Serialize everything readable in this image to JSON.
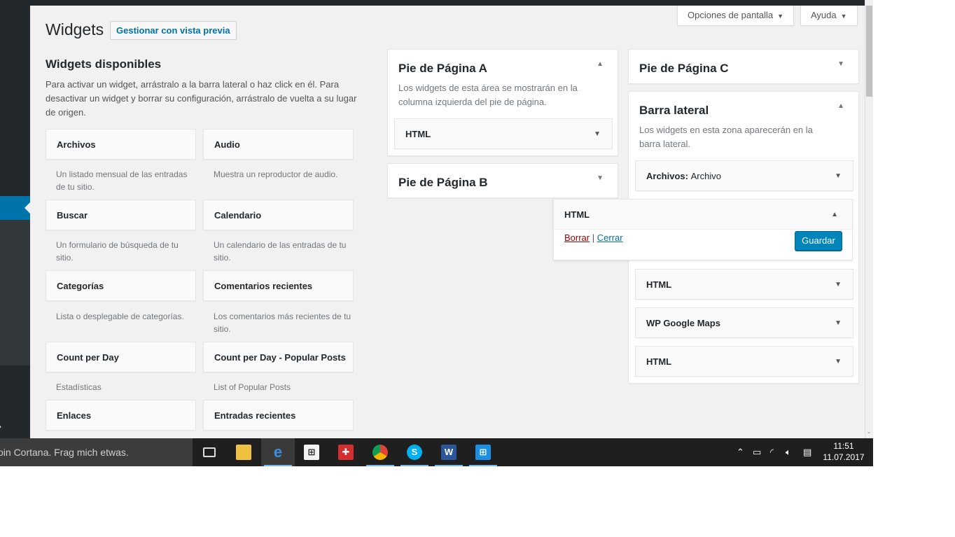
{
  "screen_meta": {
    "screen_options": "Opciones de pantalla",
    "help": "Ayuda"
  },
  "page": {
    "title": "Widgets",
    "preview_button": "Gestionar con vista previa"
  },
  "available": {
    "heading": "Widgets disponibles",
    "description": "Para activar un widget, arrástralo a la barra lateral o haz click en él. Para desactivar un widget y borrar su configuración, arrástralo de vuelta a su lugar de origen.",
    "widgets": [
      {
        "name": "Archivos",
        "desc": "Un listado mensual de las entradas de tu sitio."
      },
      {
        "name": "Audio",
        "desc": "Muestra un reproductor de audio."
      },
      {
        "name": "Buscar",
        "desc": "Un formulario de búsqueda de tu sitio."
      },
      {
        "name": "Calendario",
        "desc": "Un calendario de las entradas de tu sitio."
      },
      {
        "name": "Categorías",
        "desc": "Lista o desplegable de categorías."
      },
      {
        "name": "Comentarios recientes",
        "desc": "Los comentarios más recientes de tu sitio."
      },
      {
        "name": "Count per Day",
        "desc": "Estadísticas"
      },
      {
        "name": "Count per Day - Popular Posts",
        "desc": "List of Popular Posts"
      },
      {
        "name": "Enlaces",
        "desc": ""
      },
      {
        "name": "Entradas recientes",
        "desc": ""
      }
    ]
  },
  "areas": {
    "footer_a": {
      "title": "Pie de Página A",
      "description": "Los widgets de esta área se mostrarán en la columna izquierda del pie de página.",
      "widgets": [
        "HTML"
      ]
    },
    "footer_b": {
      "title": "Pie de Página B"
    },
    "footer_c": {
      "title": "Pie de Página C"
    },
    "sidebar": {
      "title": "Barra lateral",
      "description": "Los widgets en esta zona aparecerán en la barra lateral.",
      "widget_archive": {
        "name": "Archivos",
        "sep": ":",
        "instance_title": "Archivo"
      },
      "widgets_below": [
        "HTML",
        "WP Google Maps",
        "HTML"
      ]
    }
  },
  "open_widget": {
    "name": "HTML",
    "delete_label": "Borrar",
    "separator": "|",
    "close_label": "Cerrar",
    "save_label": "Guardar"
  },
  "taskbar": {
    "search_text": "oin Cortana. Frag mich etwas.",
    "apps": [
      "task-view",
      "file-explorer",
      "edge",
      "store",
      "gift",
      "chrome",
      "skype",
      "word",
      "windows"
    ],
    "time": "11:51",
    "date": "11.07.2017"
  },
  "colors": {
    "admin_menu": "#23282d",
    "accent_blue": "#0073aa",
    "primary_button": "#0085ba",
    "delete_red": "#a00",
    "taskbar": "#1f1f1f"
  },
  "icons": {
    "collapsed_toggle": "triangle-down",
    "expanded_toggle": "triangle-up"
  }
}
